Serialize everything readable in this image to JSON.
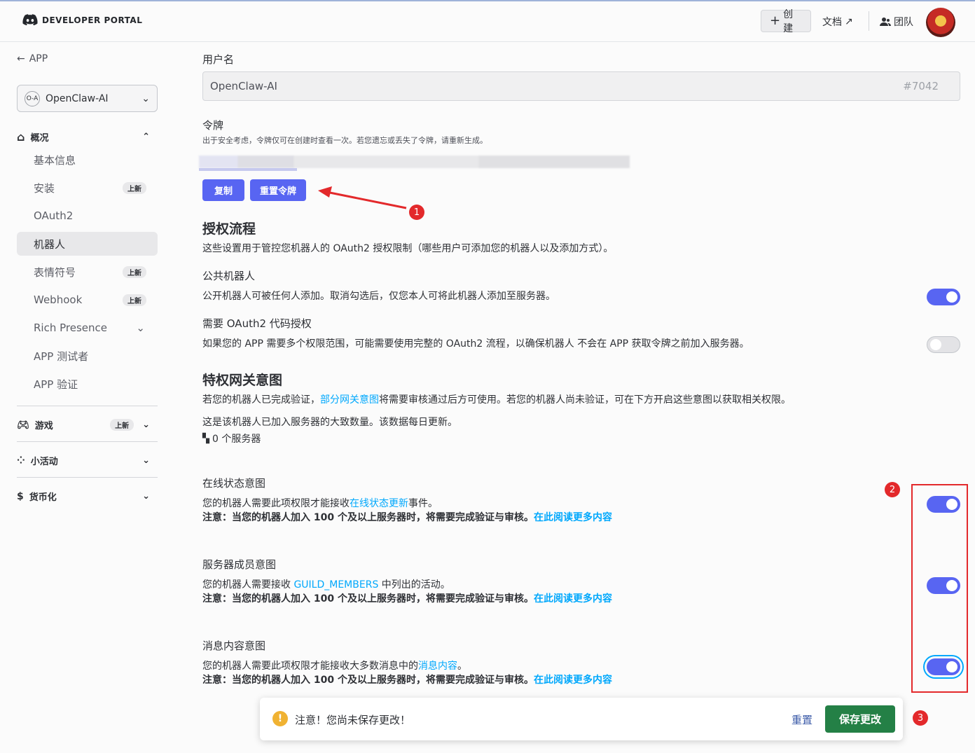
{
  "header": {
    "logo_text": "DEVELOPER PORTAL",
    "create_label": "创建",
    "docs_label": "文档",
    "team_label": "团队"
  },
  "sidebar": {
    "back_label": "APP",
    "app_icon_text": "O-A",
    "app_name": "OpenClaw-AI",
    "overview_label": "概况",
    "items": [
      {
        "label": "基本信息",
        "badge": ""
      },
      {
        "label": "安装",
        "badge": "上新"
      },
      {
        "label": "OAuth2",
        "badge": ""
      },
      {
        "label": "机器人",
        "badge": ""
      },
      {
        "label": "表情符号",
        "badge": "上新"
      },
      {
        "label": "Webhook",
        "badge": "上新"
      },
      {
        "label": "Rich Presence",
        "badge": ""
      },
      {
        "label": "APP 测试者",
        "badge": ""
      },
      {
        "label": "APP 验证",
        "badge": ""
      }
    ],
    "games_label": "游戏",
    "games_badge": "上新",
    "activities_label": "小活动",
    "monetization_label": "货币化"
  },
  "main": {
    "username_label": "用户名",
    "username_value": "OpenClaw-AI",
    "discriminator": "#7042",
    "token_label": "令牌",
    "token_desc": "出于安全考虑，令牌仅可在创建时查看一次。若您遗忘或丢失了令牌，请重新生成。",
    "copy_button": "复制",
    "reset_token_button": "重置令牌",
    "auth_flow_title": "授权流程",
    "auth_flow_desc": "这些设置用于管控您机器人的 OAuth2 授权限制（哪些用户可添加您的机器人以及添加方式）。",
    "public_bot_title": "公共机器人",
    "public_bot_desc": "公开机器人可被任何人添加。取消勾选后，仅您本人可将此机器人添加至服务器。",
    "oauth_grant_title": "需要 OAuth2 代码授权",
    "oauth_grant_desc": "如果您的 APP 需要多个权限范围，可能需要使用完整的 OAuth2 流程，以确保机器人 不会在 APP 获取令牌之前加入服务器。",
    "intents_title": "特权网关意图",
    "intents_desc_1": "若您的机器人已完成验证，",
    "intents_desc_link": "部分网关意图",
    "intents_desc_2": "将需要审核通过后方可使用。若您的机器人尚未验证，可在下方开启这些意图以获取相关权限。",
    "server_count_desc": "这是该机器人已加入服务器的大致数量。该数据每日更新。",
    "server_count": "0 个服务器",
    "presence_title": "在线状态意图",
    "presence_desc_1": "您的机器人需要此项权限才能接收",
    "presence_desc_link": "在线状态更新",
    "presence_desc_2": "事件。",
    "members_title": "服务器成员意图",
    "members_desc_1": "您的机器人需要接收 ",
    "members_desc_link": "GUILD_MEMBERS",
    "members_desc_2": " 中列出的活动。",
    "message_title": "消息内容意图",
    "message_desc_1": "您的机器人需要此项权限才能接收大多数消息中的",
    "message_desc_link": "消息内容",
    "message_desc_2": "。",
    "note_text": "注意：当您的机器人加入 100 个及以上服务器时，将需要完成验证与审核。",
    "read_more": "在此阅读更多内容"
  },
  "toggles": {
    "public_bot": true,
    "oauth_grant": false,
    "presence": true,
    "members": true,
    "message": true
  },
  "annotations": [
    "1",
    "2",
    "3"
  ],
  "notice": {
    "text": "注意！您尚未保存更改！",
    "reset_label": "重置",
    "save_label": "保存更改"
  },
  "colors": {
    "accent": "#5865f2",
    "link": "#00a8fc",
    "save": "#248046",
    "annotation": "#e3292b"
  }
}
